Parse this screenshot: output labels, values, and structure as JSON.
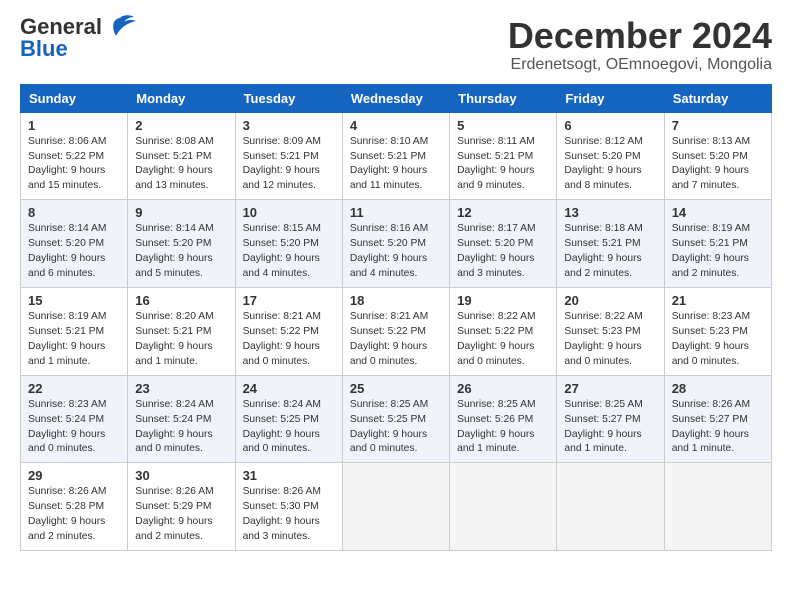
{
  "header": {
    "logo_general": "General",
    "logo_blue": "Blue",
    "month_title": "December 2024",
    "location": "Erdenetsogt, OEmnoegovi, Mongolia"
  },
  "days_of_week": [
    "Sunday",
    "Monday",
    "Tuesday",
    "Wednesday",
    "Thursday",
    "Friday",
    "Saturday"
  ],
  "weeks": [
    [
      {
        "day": 1,
        "sunrise": "Sunrise: 8:06 AM",
        "sunset": "Sunset: 5:22 PM",
        "daylight": "Daylight: 9 hours and 15 minutes."
      },
      {
        "day": 2,
        "sunrise": "Sunrise: 8:08 AM",
        "sunset": "Sunset: 5:21 PM",
        "daylight": "Daylight: 9 hours and 13 minutes."
      },
      {
        "day": 3,
        "sunrise": "Sunrise: 8:09 AM",
        "sunset": "Sunset: 5:21 PM",
        "daylight": "Daylight: 9 hours and 12 minutes."
      },
      {
        "day": 4,
        "sunrise": "Sunrise: 8:10 AM",
        "sunset": "Sunset: 5:21 PM",
        "daylight": "Daylight: 9 hours and 11 minutes."
      },
      {
        "day": 5,
        "sunrise": "Sunrise: 8:11 AM",
        "sunset": "Sunset: 5:21 PM",
        "daylight": "Daylight: 9 hours and 9 minutes."
      },
      {
        "day": 6,
        "sunrise": "Sunrise: 8:12 AM",
        "sunset": "Sunset: 5:20 PM",
        "daylight": "Daylight: 9 hours and 8 minutes."
      },
      {
        "day": 7,
        "sunrise": "Sunrise: 8:13 AM",
        "sunset": "Sunset: 5:20 PM",
        "daylight": "Daylight: 9 hours and 7 minutes."
      }
    ],
    [
      {
        "day": 8,
        "sunrise": "Sunrise: 8:14 AM",
        "sunset": "Sunset: 5:20 PM",
        "daylight": "Daylight: 9 hours and 6 minutes."
      },
      {
        "day": 9,
        "sunrise": "Sunrise: 8:14 AM",
        "sunset": "Sunset: 5:20 PM",
        "daylight": "Daylight: 9 hours and 5 minutes."
      },
      {
        "day": 10,
        "sunrise": "Sunrise: 8:15 AM",
        "sunset": "Sunset: 5:20 PM",
        "daylight": "Daylight: 9 hours and 4 minutes."
      },
      {
        "day": 11,
        "sunrise": "Sunrise: 8:16 AM",
        "sunset": "Sunset: 5:20 PM",
        "daylight": "Daylight: 9 hours and 4 minutes."
      },
      {
        "day": 12,
        "sunrise": "Sunrise: 8:17 AM",
        "sunset": "Sunset: 5:20 PM",
        "daylight": "Daylight: 9 hours and 3 minutes."
      },
      {
        "day": 13,
        "sunrise": "Sunrise: 8:18 AM",
        "sunset": "Sunset: 5:21 PM",
        "daylight": "Daylight: 9 hours and 2 minutes."
      },
      {
        "day": 14,
        "sunrise": "Sunrise: 8:19 AM",
        "sunset": "Sunset: 5:21 PM",
        "daylight": "Daylight: 9 hours and 2 minutes."
      }
    ],
    [
      {
        "day": 15,
        "sunrise": "Sunrise: 8:19 AM",
        "sunset": "Sunset: 5:21 PM",
        "daylight": "Daylight: 9 hours and 1 minute."
      },
      {
        "day": 16,
        "sunrise": "Sunrise: 8:20 AM",
        "sunset": "Sunset: 5:21 PM",
        "daylight": "Daylight: 9 hours and 1 minute."
      },
      {
        "day": 17,
        "sunrise": "Sunrise: 8:21 AM",
        "sunset": "Sunset: 5:22 PM",
        "daylight": "Daylight: 9 hours and 0 minutes."
      },
      {
        "day": 18,
        "sunrise": "Sunrise: 8:21 AM",
        "sunset": "Sunset: 5:22 PM",
        "daylight": "Daylight: 9 hours and 0 minutes."
      },
      {
        "day": 19,
        "sunrise": "Sunrise: 8:22 AM",
        "sunset": "Sunset: 5:22 PM",
        "daylight": "Daylight: 9 hours and 0 minutes."
      },
      {
        "day": 20,
        "sunrise": "Sunrise: 8:22 AM",
        "sunset": "Sunset: 5:23 PM",
        "daylight": "Daylight: 9 hours and 0 minutes."
      },
      {
        "day": 21,
        "sunrise": "Sunrise: 8:23 AM",
        "sunset": "Sunset: 5:23 PM",
        "daylight": "Daylight: 9 hours and 0 minutes."
      }
    ],
    [
      {
        "day": 22,
        "sunrise": "Sunrise: 8:23 AM",
        "sunset": "Sunset: 5:24 PM",
        "daylight": "Daylight: 9 hours and 0 minutes."
      },
      {
        "day": 23,
        "sunrise": "Sunrise: 8:24 AM",
        "sunset": "Sunset: 5:24 PM",
        "daylight": "Daylight: 9 hours and 0 minutes."
      },
      {
        "day": 24,
        "sunrise": "Sunrise: 8:24 AM",
        "sunset": "Sunset: 5:25 PM",
        "daylight": "Daylight: 9 hours and 0 minutes."
      },
      {
        "day": 25,
        "sunrise": "Sunrise: 8:25 AM",
        "sunset": "Sunset: 5:25 PM",
        "daylight": "Daylight: 9 hours and 0 minutes."
      },
      {
        "day": 26,
        "sunrise": "Sunrise: 8:25 AM",
        "sunset": "Sunset: 5:26 PM",
        "daylight": "Daylight: 9 hours and 1 minute."
      },
      {
        "day": 27,
        "sunrise": "Sunrise: 8:25 AM",
        "sunset": "Sunset: 5:27 PM",
        "daylight": "Daylight: 9 hours and 1 minute."
      },
      {
        "day": 28,
        "sunrise": "Sunrise: 8:26 AM",
        "sunset": "Sunset: 5:27 PM",
        "daylight": "Daylight: 9 hours and 1 minute."
      }
    ],
    [
      {
        "day": 29,
        "sunrise": "Sunrise: 8:26 AM",
        "sunset": "Sunset: 5:28 PM",
        "daylight": "Daylight: 9 hours and 2 minutes."
      },
      {
        "day": 30,
        "sunrise": "Sunrise: 8:26 AM",
        "sunset": "Sunset: 5:29 PM",
        "daylight": "Daylight: 9 hours and 2 minutes."
      },
      {
        "day": 31,
        "sunrise": "Sunrise: 8:26 AM",
        "sunset": "Sunset: 5:30 PM",
        "daylight": "Daylight: 9 hours and 3 minutes."
      },
      null,
      null,
      null,
      null
    ]
  ]
}
